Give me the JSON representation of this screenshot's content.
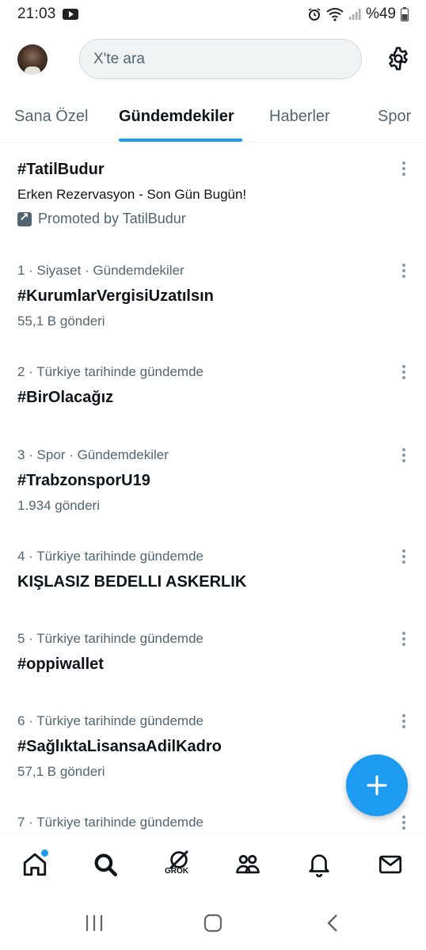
{
  "status_bar": {
    "time": "21:03",
    "battery": "%49"
  },
  "search": {
    "placeholder": "X'te ara"
  },
  "tabs": [
    {
      "label": "Sana Özel"
    },
    {
      "label": "Gündemdekiler"
    },
    {
      "label": "Haberler"
    },
    {
      "label": "Spor"
    }
  ],
  "promoted_trend": {
    "title": "#TatilBudur",
    "description": "Erken Rezervasyon - Son Gün Bugün!",
    "promoted_by": "Promoted by TatilBudur"
  },
  "trends": [
    {
      "meta": "1 · Siyaset · Gündemdekiler",
      "title": "#KurumlarVergisiUzatılsın",
      "posts": "55,1 B gönderi"
    },
    {
      "meta": "2 · Türkiye tarihinde gündemde",
      "title": "#BirOlacağız",
      "posts": ""
    },
    {
      "meta": "3 · Spor · Gündemdekiler",
      "title": "#TrabzonsporU19",
      "posts": "1.934 gönderi"
    },
    {
      "meta": "4 · Türkiye tarihinde gündemde",
      "title": "KIŞLASIZ BEDELLI ASKERLIK",
      "posts": ""
    },
    {
      "meta": "5 · Türkiye tarihinde gündemde",
      "title": "#oppiwallet",
      "posts": ""
    },
    {
      "meta": "6 · Türkiye tarihinde gündemde",
      "title": "#SağlıktaLisansaAdilKadro",
      "posts": "57,1 B gönderi"
    },
    {
      "meta": "7 · Türkiye tarihinde gündemde",
      "title": "",
      "posts": ""
    }
  ],
  "bottom_nav": {
    "grok_label": "GROK"
  },
  "colors": {
    "accent": "#1d9bf0",
    "text_primary": "#0f1419",
    "text_secondary": "#536471"
  }
}
